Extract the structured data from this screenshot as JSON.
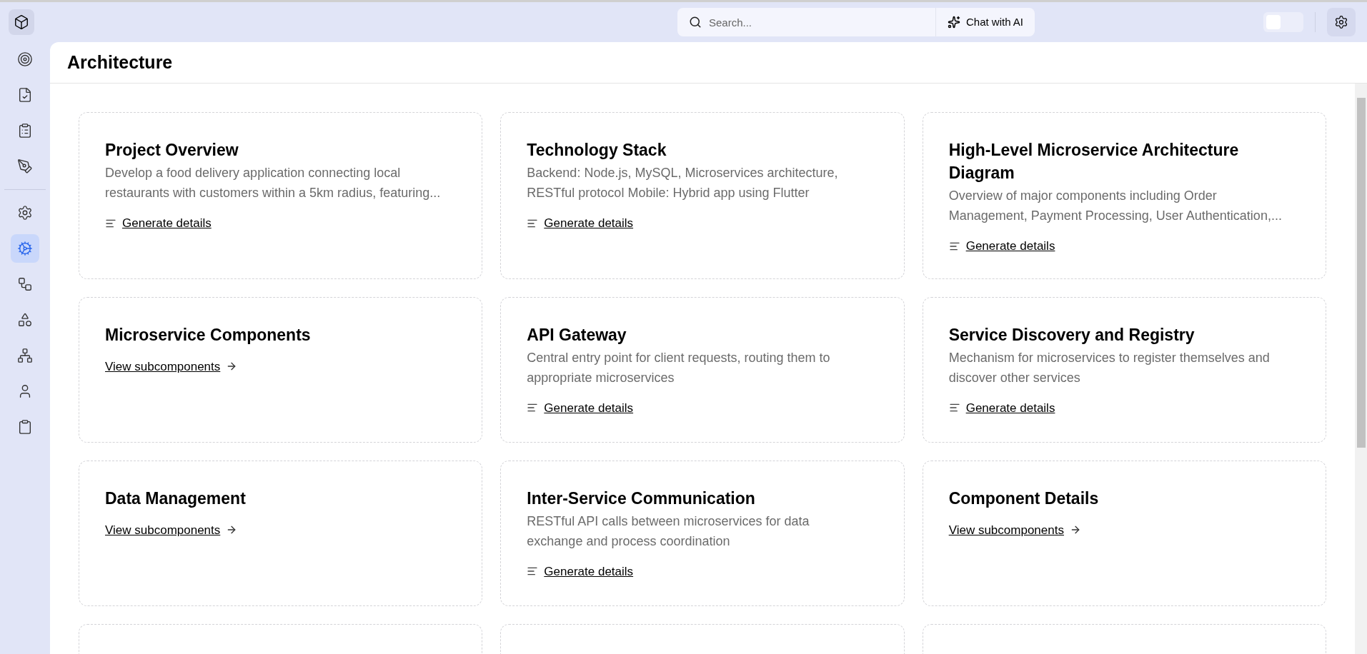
{
  "top_bar": {
    "search": {
      "placeholder": "Search..."
    },
    "chat_button": "Chat with AI",
    "theme_toggle": {
      "on": false
    }
  },
  "sidebar": {
    "top_items": [
      {
        "selected": false
      },
      {
        "selected": false
      },
      {
        "selected": false
      },
      {
        "selected": false
      }
    ],
    "bottom_items": [
      {
        "selected": false
      },
      {
        "selected": true
      },
      {
        "selected": false
      },
      {
        "selected": false
      },
      {
        "selected": false
      },
      {
        "selected": false
      },
      {
        "selected": false
      }
    ]
  },
  "page": {
    "title": "Architecture"
  },
  "cards": [
    {
      "kind": "generate",
      "title": "Project Overview",
      "description": "Develop a food delivery application connecting local restaurants with customers within a 5km radius, featuring...",
      "action": "Generate details"
    },
    {
      "kind": "generate",
      "title": "Technology Stack",
      "description": "Backend: Node.js, MySQL, Microservices architecture, RESTful protocol Mobile: Hybrid app using Flutter",
      "action": "Generate details"
    },
    {
      "kind": "generate",
      "title": "High-Level Microservice Architecture Diagram",
      "description": "Overview of major components including Order Management, Payment Processing, User Authentication,...",
      "action": "Generate details"
    },
    {
      "kind": "subcomponents",
      "title": "Microservice Components",
      "action": "View subcomponents"
    },
    {
      "kind": "generate",
      "title": "API Gateway",
      "description": "Central entry point for client requests, routing them to appropriate microservices",
      "action": "Generate details"
    },
    {
      "kind": "generate",
      "title": "Service Discovery and Registry",
      "description": "Mechanism for microservices to register themselves and discover other services",
      "action": "Generate details"
    },
    {
      "kind": "subcomponents",
      "title": "Data Management",
      "action": "View subcomponents"
    },
    {
      "kind": "generate",
      "title": "Inter-Service Communication",
      "description": "RESTful API calls between microservices for data exchange and process coordination",
      "action": "Generate details"
    },
    {
      "kind": "subcomponents",
      "title": "Component Details",
      "action": "View subcomponents"
    },
    {
      "kind": "cut_off"
    },
    {
      "kind": "cut_off"
    },
    {
      "kind": "cut_off"
    }
  ]
}
